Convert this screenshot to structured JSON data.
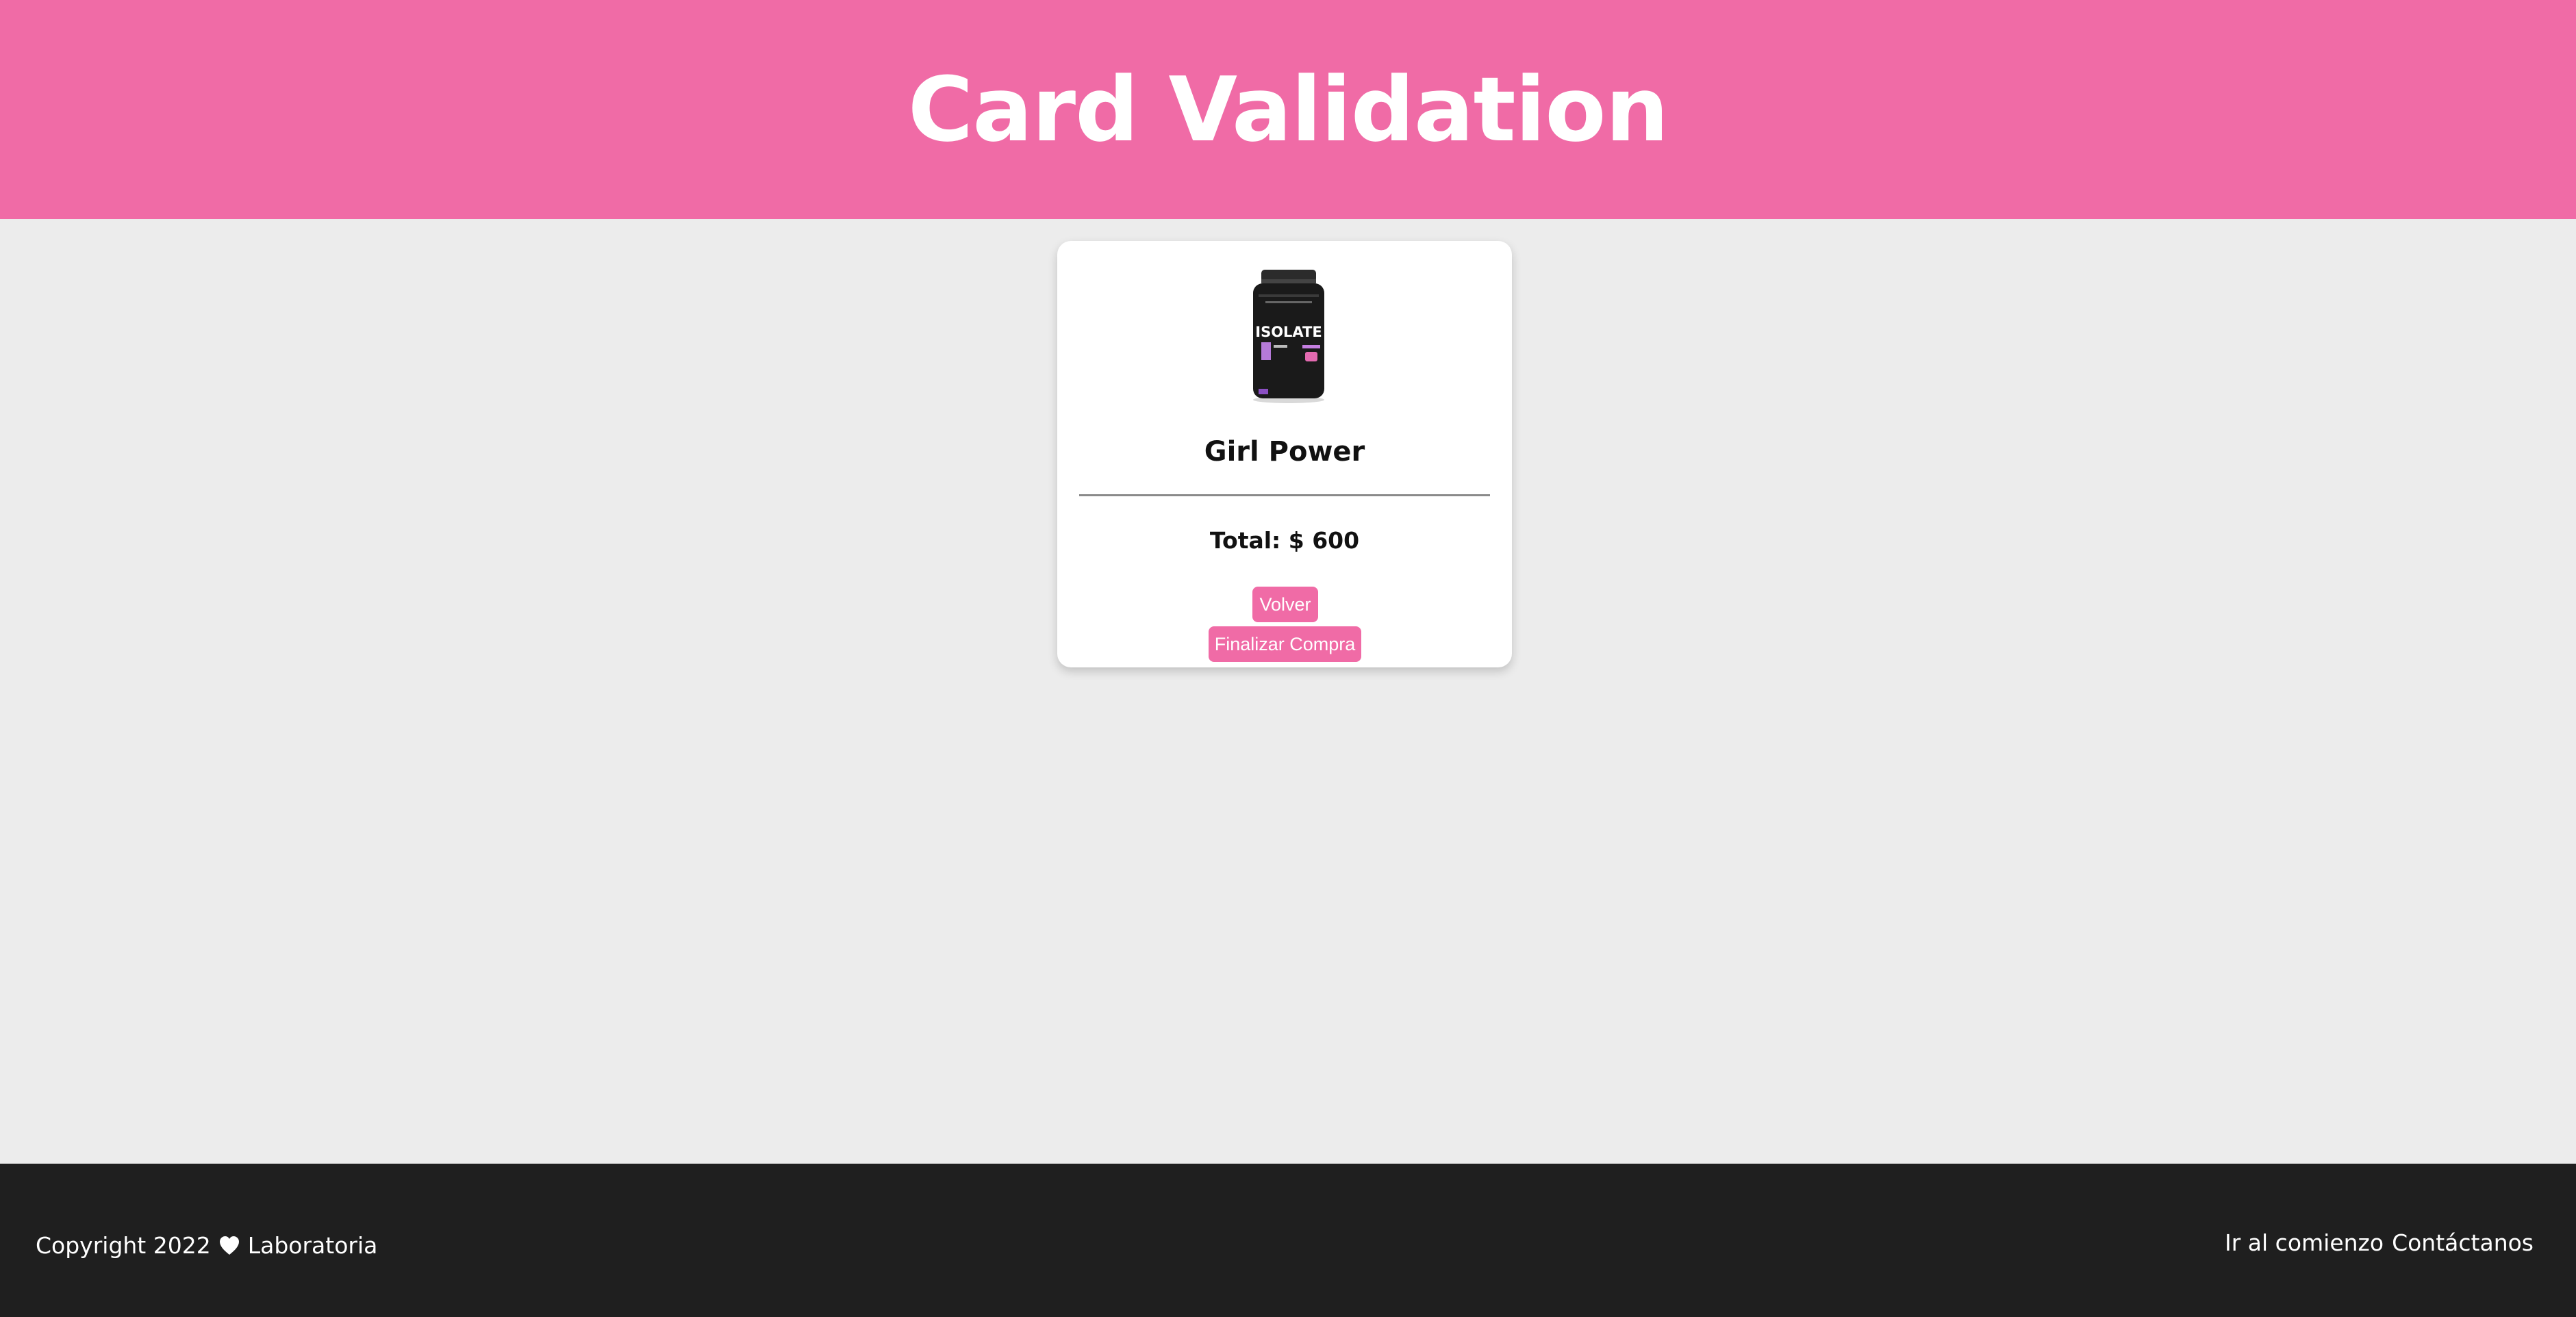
{
  "header": {
    "title": "Card Validation"
  },
  "card": {
    "product_image": {
      "label": "ISOLATE",
      "icon": "protein-jar-image"
    },
    "product_name": "Girl Power",
    "total": "Total: $ 600",
    "buttons": {
      "back_label": "Volver",
      "finish_label": "Finalizar Compra"
    }
  },
  "footer": {
    "copyright_prefix": "Copyright 2022",
    "copyright_suffix": "Laboratoria",
    "links": {
      "top_label": "Ir al comienzo",
      "contact_label": "Contáctanos"
    }
  },
  "colors": {
    "accent": "#f06ba6",
    "background": "#ececec",
    "footer": "#1f1f1f",
    "card": "#ffffff"
  }
}
